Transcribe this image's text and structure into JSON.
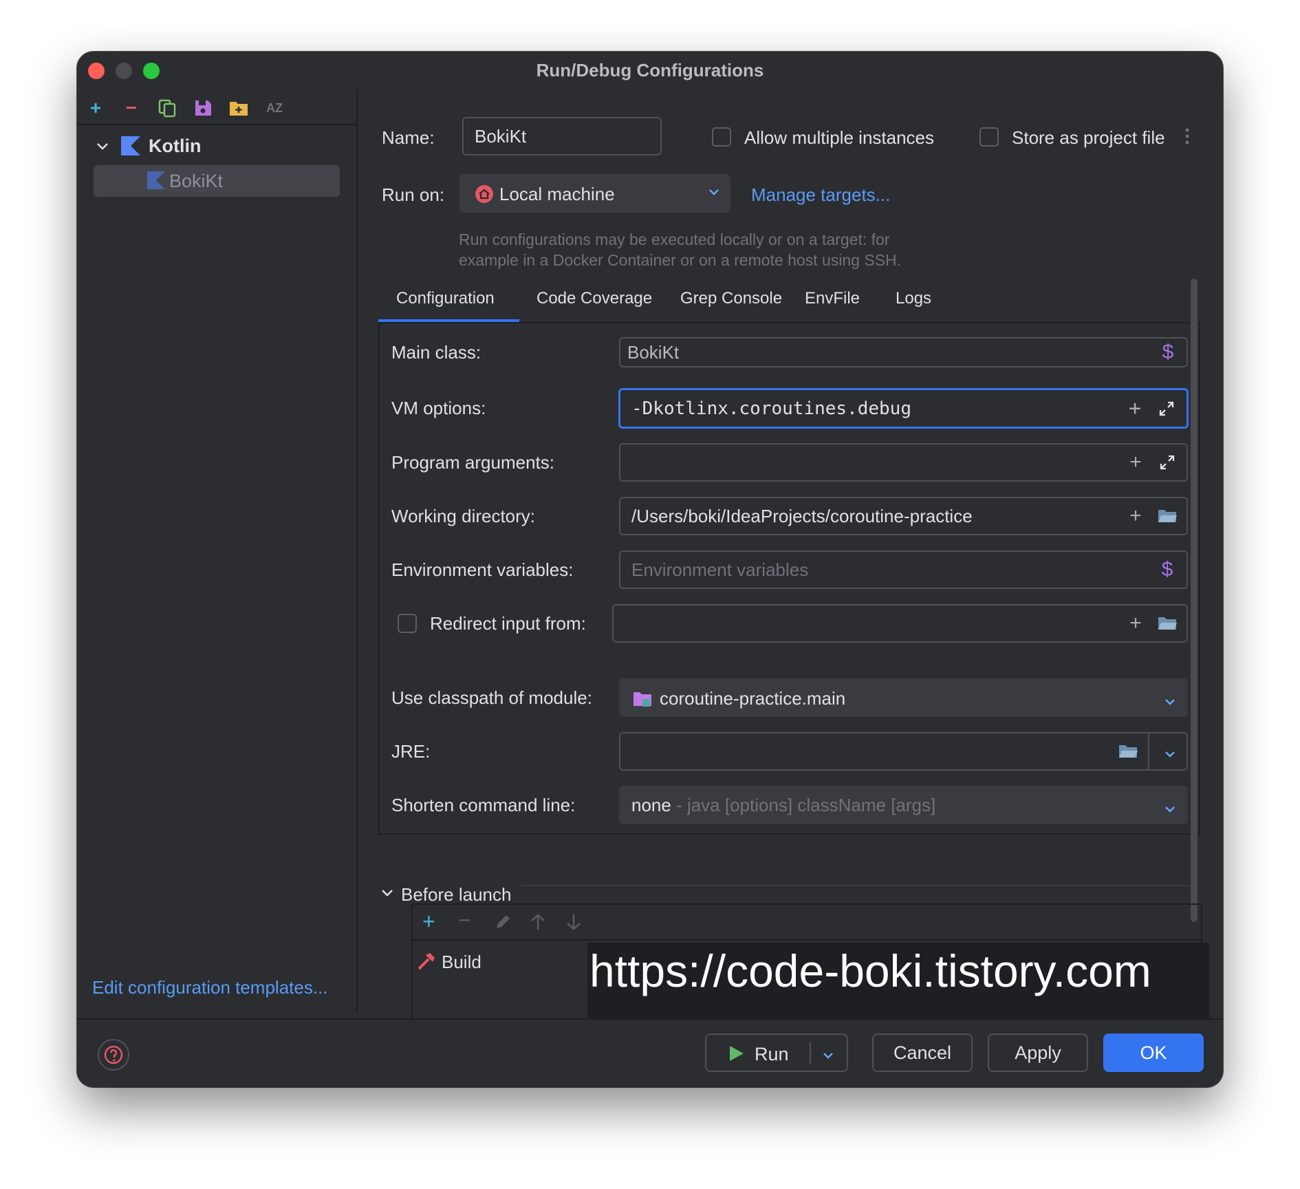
{
  "window": {
    "title": "Run/Debug Configurations"
  },
  "sidebar": {
    "tree": [
      {
        "label": "Kotlin",
        "children": [
          {
            "label": "BokiKt"
          }
        ]
      }
    ],
    "edit_templates_link": "Edit configuration templates..."
  },
  "form": {
    "name_label": "Name:",
    "name_value": "BokiKt",
    "allow_multiple_label": "Allow multiple instances",
    "store_project_label": "Store as project file",
    "run_on_label": "Run on:",
    "run_on_value": "Local machine",
    "manage_targets_link": "Manage targets...",
    "run_on_hint_line1": "Run configurations may be executed locally or on a target: for",
    "run_on_hint_line2": "example in a Docker Container or on a remote host using SSH."
  },
  "tabs": [
    "Configuration",
    "Code Coverage",
    "Grep Console",
    "EnvFile",
    "Logs"
  ],
  "active_tab": "Configuration",
  "configuration": {
    "main_class_label": "Main class:",
    "main_class_value": "BokiKt",
    "vm_options_label": "VM options:",
    "vm_options_value": "-Dkotlinx.coroutines.debug",
    "program_args_label": "Program arguments:",
    "program_args_value": "",
    "working_dir_label": "Working directory:",
    "working_dir_value": "/Users/boki/IdeaProjects/coroutine-practice",
    "env_vars_label": "Environment variables:",
    "env_vars_placeholder": "Environment variables",
    "redirect_label": "Redirect input from:",
    "classpath_label": "Use classpath of module:",
    "classpath_value": "coroutine-practice.main",
    "jre_label": "JRE:",
    "jre_value": "",
    "shorten_label": "Shorten command line:",
    "shorten_value": "none",
    "shorten_hint": " - java [options] className [args]"
  },
  "before_launch": {
    "title": "Before launch",
    "items": [
      "Build"
    ]
  },
  "watermark": "https://code-boki.tistory.com",
  "footer": {
    "run_label": "Run",
    "cancel_label": "Cancel",
    "apply_label": "Apply",
    "ok_label": "OK"
  },
  "colors": {
    "background": "#2b2d30",
    "accent": "#3574f0",
    "link": "#5a9bf6",
    "kotlin": "#7f52ff",
    "add_green": "#5fb865"
  }
}
